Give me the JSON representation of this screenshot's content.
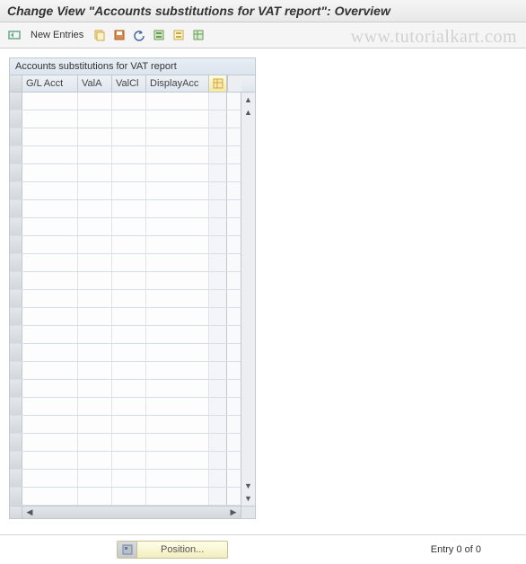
{
  "header": {
    "title": "Change View \"Accounts substitutions for VAT report\": Overview"
  },
  "toolbar": {
    "new_entries": "New Entries"
  },
  "panel": {
    "title": "Accounts substitutions for VAT report",
    "columns": {
      "c1": "G/L Acct",
      "c2": "ValA",
      "c3": "ValCl",
      "c4": "DisplayAcc"
    },
    "row_count": 23
  },
  "footer": {
    "position_label": "Position...",
    "entry_text": "Entry 0 of 0"
  },
  "watermark": "www.tutorialkart.com"
}
